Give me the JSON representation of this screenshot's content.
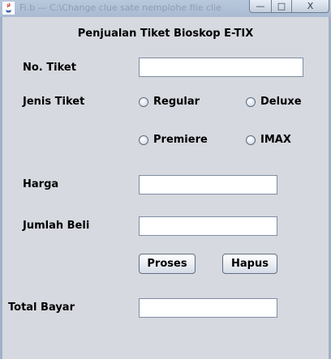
{
  "window": {
    "title_ghost": "Fi.b — C:\\Change clue   sate  nemplohe  file   clie",
    "minimize_glyph": "—",
    "maximize_glyph": "□",
    "close_glyph": "X"
  },
  "form": {
    "heading": "Penjualan Tiket Bioskop E-TIX",
    "no_tiket_label": "No. Tiket",
    "no_tiket_value": "",
    "jenis_tiket_label": "Jenis Tiket",
    "radio_options": [
      "Regular",
      "Deluxe",
      "Premiere",
      "IMAX"
    ],
    "harga_label": "Harga",
    "harga_value": "",
    "jumlah_beli_label": "Jumlah Beli",
    "jumlah_beli_value": "",
    "proses_label": "Proses",
    "hapus_label": "Hapus",
    "total_bayar_label": "Total Bayar",
    "total_bayar_value": ""
  }
}
